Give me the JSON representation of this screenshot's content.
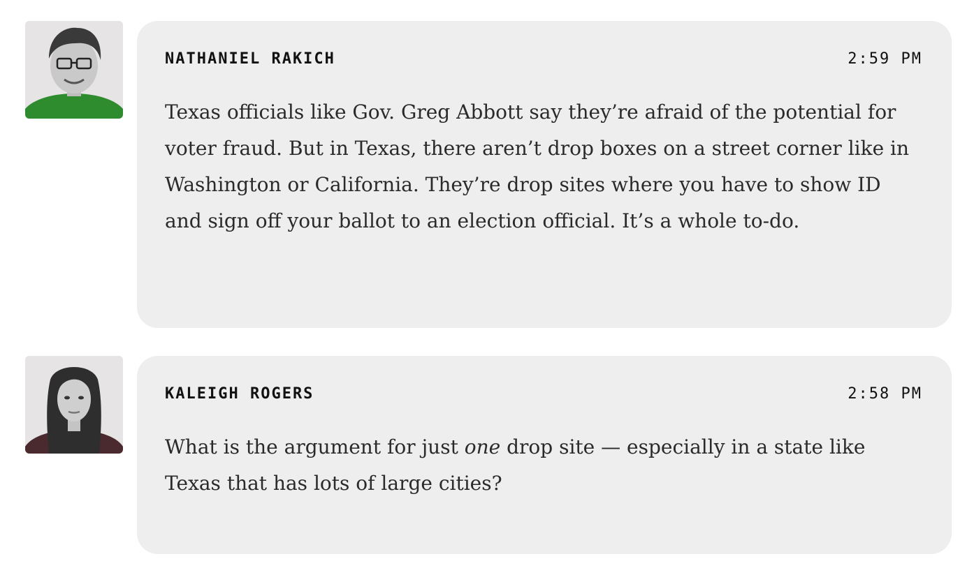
{
  "messages": [
    {
      "author": "NATHANIEL RAKICH",
      "time": "2:59 PM",
      "body": "Texas officials like Gov. Greg Abbott say they’re afraid of the potential for voter fraud. But in Texas, there aren’t drop boxes on a street corner like in Washington or California. They’re drop sites where you have to show ID and sign off your ballot to an election official. It’s a whole to-do."
    },
    {
      "author": "KALEIGH ROGERS",
      "time": "2:58 PM",
      "body_before": "What is the argument for just ",
      "body_emphasis": "one",
      "body_after": " drop site — especially in a state like Texas that has lots of large cities?"
    }
  ]
}
